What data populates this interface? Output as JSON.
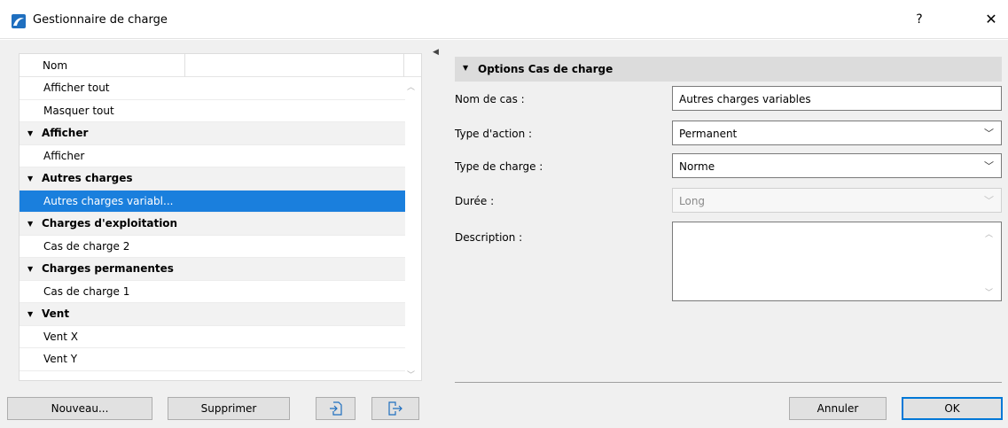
{
  "window": {
    "title": "Gestionnaire de charge",
    "help_label": "?",
    "close_label": "✕"
  },
  "tree": {
    "column_header": "Nom",
    "rows": [
      {
        "label": "Afficher tout",
        "type": "item"
      },
      {
        "label": "Masquer tout",
        "type": "item"
      },
      {
        "label": "Afficher",
        "type": "group"
      },
      {
        "label": "Afficher",
        "type": "item"
      },
      {
        "label": "Autres charges",
        "type": "group"
      },
      {
        "label": "Autres charges variabl...",
        "type": "item",
        "selected": true
      },
      {
        "label": "Charges d'exploitation",
        "type": "group"
      },
      {
        "label": "Cas de charge 2",
        "type": "item"
      },
      {
        "label": "Charges permanentes",
        "type": "group"
      },
      {
        "label": "Cas de charge 1",
        "type": "item"
      },
      {
        "label": "Vent",
        "type": "group"
      },
      {
        "label": "Vent X",
        "type": "item"
      },
      {
        "label": "Vent Y",
        "type": "item"
      }
    ]
  },
  "left_buttons": {
    "nouveau": "Nouveau...",
    "supprimer": "Supprimer"
  },
  "options": {
    "section_title": "Options Cas de charge",
    "nom_label": "Nom de cas :",
    "nom_value": "Autres charges variables",
    "action_label": "Type d'action :",
    "action_value": "Permanent",
    "type_label": "Type de charge :",
    "type_value": "Norme",
    "duree_label": "Durée :",
    "duree_value": "Long",
    "desc_label": "Description :",
    "desc_value": ""
  },
  "footer": {
    "annuler": "Annuler",
    "ok": "OK"
  },
  "colors": {
    "selection": "#1a7fdd",
    "dialog_bg": "#f0f0f0",
    "section_bg": "#dcdcdc",
    "ok_border": "#0078d7",
    "app_icon": "#1f6fbf"
  }
}
